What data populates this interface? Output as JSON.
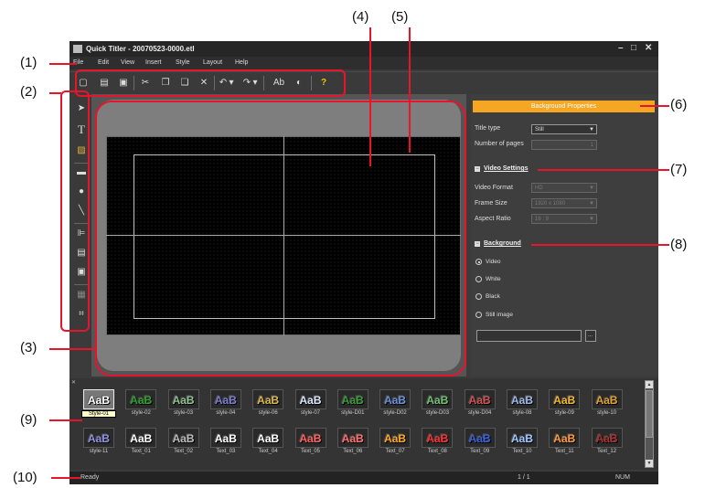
{
  "callouts": [
    "(1)",
    "(2)",
    "(3)",
    "(4)",
    "(5)",
    "(6)",
    "(7)",
    "(8)",
    "(9)",
    "(10)"
  ],
  "window": {
    "title": "Quick Titler - 20070523-0000.etl",
    "min": "–",
    "max": "□",
    "close": "✕"
  },
  "menu": [
    "File",
    "Edit",
    "View",
    "Insert",
    "Style",
    "Layout",
    "Help"
  ],
  "toolbar_icons": [
    "new-file-icon",
    "open-folder-icon",
    "save-icon",
    "cut-icon",
    "copy-icon",
    "paste-icon",
    "delete-icon",
    "undo-icon",
    "dropdown-arrow-icon",
    "redo-icon",
    "dropdown-arrow-icon",
    "text-style-icon",
    "palette-icon",
    "help-icon"
  ],
  "toolbar_glyphs": [
    "▢",
    "▤",
    "▣",
    "✂",
    "❐",
    "❏",
    "✕",
    "↶",
    "▾",
    "↷",
    "▾",
    "Ab",
    "◐",
    "?"
  ],
  "left_tools": [
    {
      "icon": "pointer-icon",
      "g": "➤"
    },
    {
      "icon": "text-tool-icon",
      "g": "T"
    },
    {
      "icon": "image-tool-icon",
      "g": "▨"
    },
    {
      "icon": "rectangle-tool-icon",
      "g": "▬"
    },
    {
      "icon": "ellipse-tool-icon",
      "g": "●"
    },
    {
      "icon": "line-tool-icon",
      "g": "╲"
    },
    {
      "icon": "align-icon",
      "g": "⊫"
    },
    {
      "icon": "distribute-icon",
      "g": "▤"
    },
    {
      "icon": "layer-order-icon",
      "g": "▣"
    },
    {
      "icon": "grid-icon",
      "g": "▦"
    },
    {
      "icon": "safe-area-icon",
      "g": "⌗"
    }
  ],
  "props": {
    "header": "Background Properties",
    "title_type_label": "Title type",
    "title_type_value": "Still",
    "pages_label": "Number of pages",
    "pages_value": "1",
    "video_settings": "Video Settings",
    "video_format_label": "Video Format",
    "video_format_value": "HD",
    "frame_size_label": "Frame Size",
    "frame_size_value": "1920 x 1080",
    "aspect_label": "Aspect Ratio",
    "aspect_value": "16 : 9",
    "background": "Background",
    "bg_options": [
      "Video",
      "White",
      "Black",
      "Still image"
    ],
    "bg_selected": "Video",
    "browse": "..."
  },
  "styles_row1": [
    "Style-01",
    "style-02",
    "style-03",
    "style-04",
    "style-06",
    "style-07",
    "style-D01",
    "style-D02",
    "style-D03",
    "style-D04",
    "style-08",
    "style-09",
    "style-10"
  ],
  "styles_row2": [
    "style-11",
    "Text_01",
    "Text_02",
    "Text_03",
    "Text_04",
    "Text_05",
    "Text_06",
    "Text_07",
    "Text_08",
    "Text_09",
    "Text_10",
    "Text_11",
    "Text_12"
  ],
  "style_sample": "AaB",
  "style_colors_row1": [
    "#ffffff",
    "#2ca02c",
    "#8fbf8f",
    "#7a7acc",
    "#d9b84a",
    "#d8e4f8",
    "#3a9a3a",
    "#6a8fd8",
    "#6fbf6f",
    "#d05050",
    "#9fb8e8",
    "#f2b82a",
    "#e0a030"
  ],
  "style_colors_row2": [
    "#9090e0",
    "#ffffff",
    "#bbbbbb",
    "#ffffff",
    "#ffffff",
    "#ff6060",
    "#ff7070",
    "#ffaa20",
    "#ff3030",
    "#3a5fd8",
    "#9fc8ff",
    "#ff9a40",
    "#a83030"
  ],
  "status": {
    "left": "Ready",
    "page": "1 / 1",
    "num": "NUM"
  }
}
